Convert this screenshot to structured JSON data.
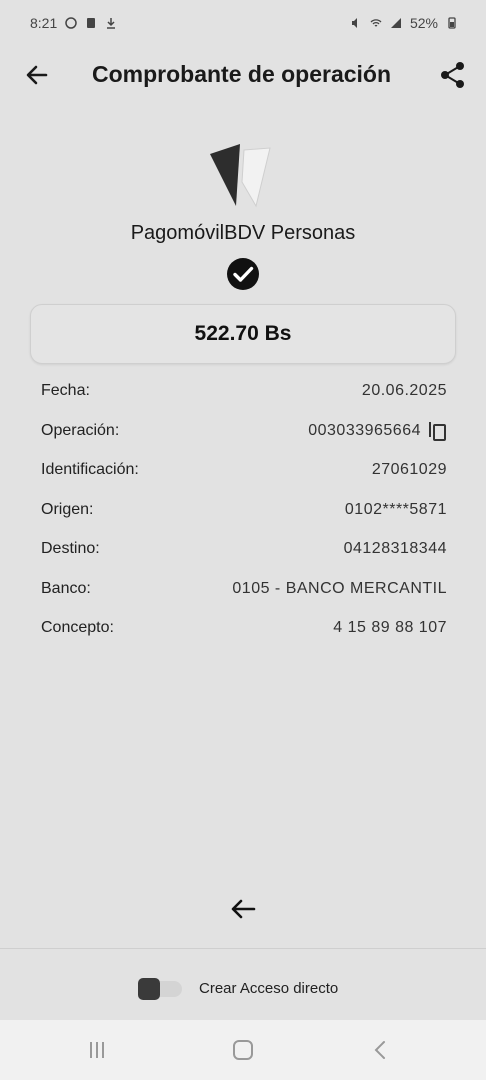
{
  "status_bar": {
    "time": "8:21",
    "battery": "52%"
  },
  "header": {
    "title": "Comprobante de operación",
    "back_icon": "arrow-left-icon",
    "share_icon": "share-icon"
  },
  "brand": {
    "name": "PagomóvilBDV Personas",
    "logo_icon": "bdv-logo-icon",
    "status_icon": "check-circle-icon"
  },
  "amount": "522.70 Bs",
  "details": [
    {
      "label": "Fecha:",
      "value": "20.06.2025"
    },
    {
      "label": "Operación:",
      "value": "003033965664"
    },
    {
      "label": "Identificación:",
      "value": "27061029"
    },
    {
      "label": "Origen:",
      "value": "0102****5871"
    },
    {
      "label": "Destino:",
      "value": "04128318344"
    },
    {
      "label": "Banco:",
      "value": "0105 - BANCO MERCANTIL"
    },
    {
      "label": "Concepto:",
      "value": "4 15 89 88 107"
    }
  ],
  "shortcut": {
    "label": "Crear Acceso directo",
    "enabled": false
  },
  "nav": {
    "recents_icon": "recents-icon",
    "home_icon": "home-icon",
    "back_icon": "nav-back-icon"
  },
  "colors": {
    "background": "#e2e2e2",
    "text": "#111111",
    "navbar": "#f1f1f1"
  }
}
